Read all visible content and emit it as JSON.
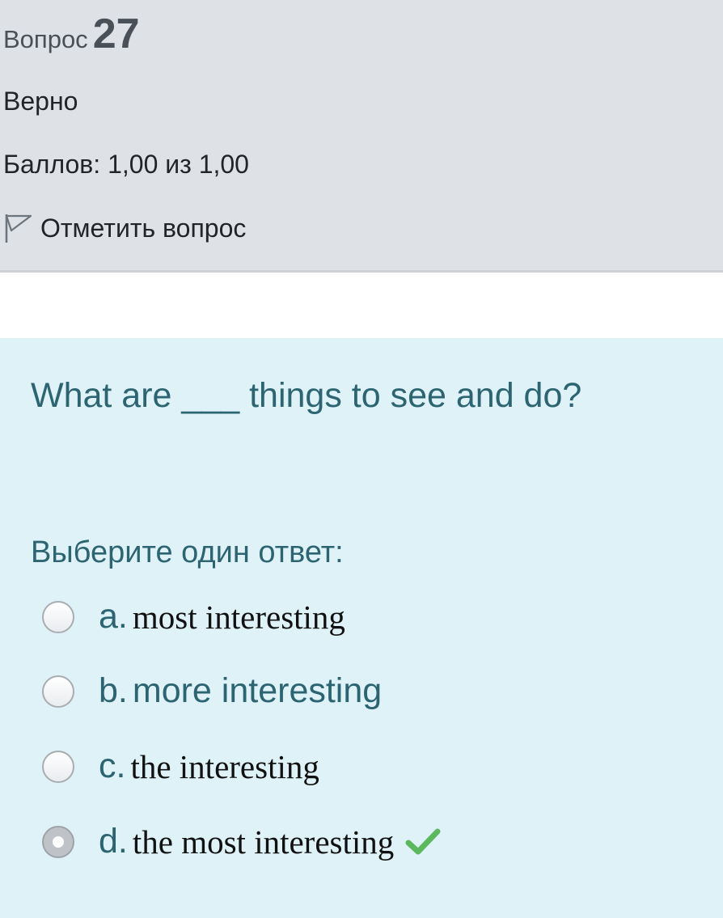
{
  "question": {
    "label": "Вопрос",
    "number": "27",
    "state": "Верно",
    "grade": "Баллов: 1,00 из 1,00",
    "flag_label": "Отметить вопрос"
  },
  "content": {
    "text": "What are ___ things to see and do?",
    "prompt": "Выберите один ответ:",
    "answers": [
      {
        "letter": "a.",
        "text": "most interesting",
        "selected": false
      },
      {
        "letter": "b.",
        "text": "more interesting",
        "selected": false
      },
      {
        "letter": "c.",
        "text": "the interesting",
        "selected": false
      },
      {
        "letter": "d.",
        "text": "the most interesting",
        "selected": true,
        "correct": true
      }
    ]
  },
  "colors": {
    "info_bg": "#dee2e6",
    "content_bg": "#def2f8",
    "accent_text": "#2c6472",
    "correct_check": "#5cb85c"
  },
  "icons": {
    "flag": "flag-icon",
    "correct": "check-icon"
  }
}
